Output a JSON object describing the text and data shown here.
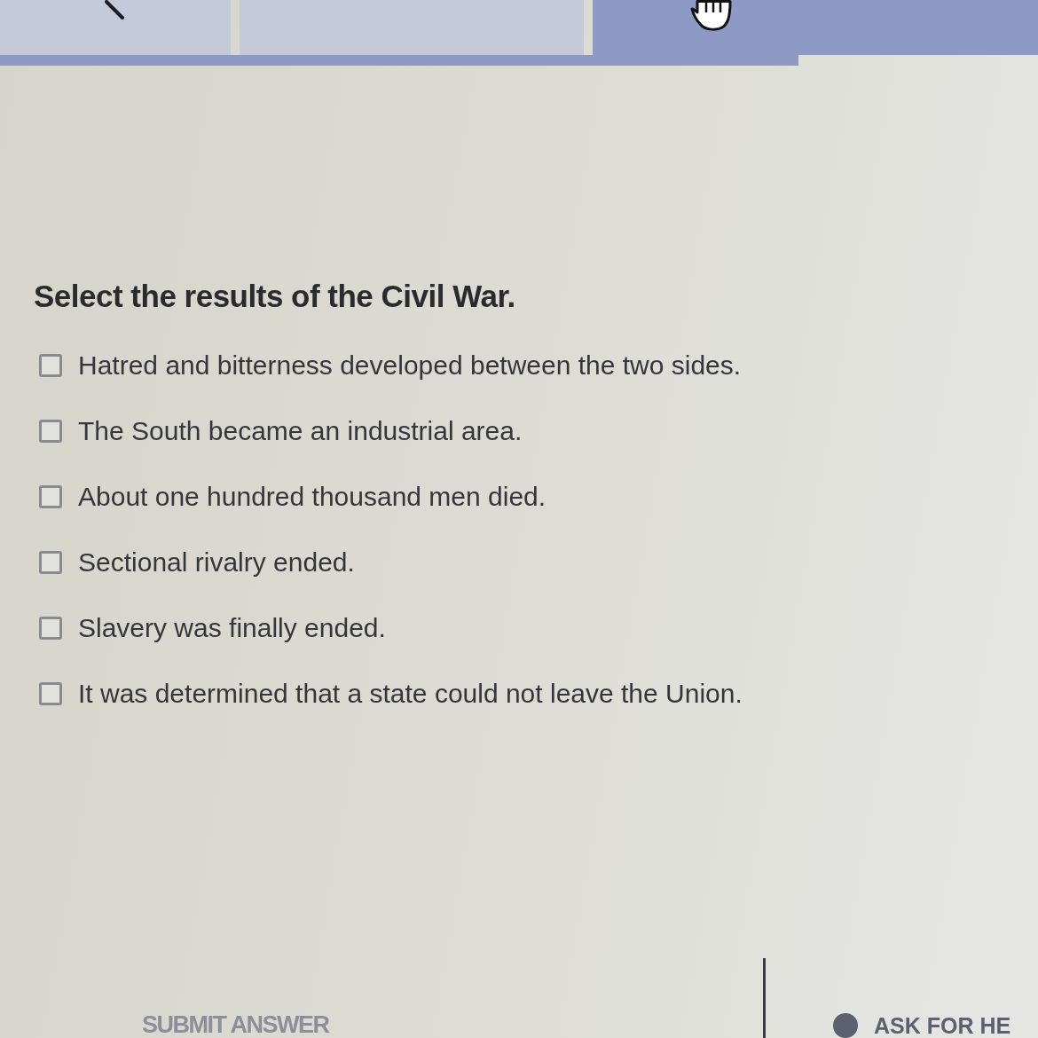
{
  "tabs": [
    {
      "selected": false
    },
    {
      "selected": false
    },
    {
      "selected": true
    }
  ],
  "question": {
    "prompt": "Select the results of the Civil War.",
    "options": [
      {
        "label": "Hatred and bitterness developed between the two sides.",
        "checked": false
      },
      {
        "label": "The South became an industrial area.",
        "checked": false
      },
      {
        "label": "About one hundred thousand men died.",
        "checked": false
      },
      {
        "label": "Sectional rivalry ended.",
        "checked": false
      },
      {
        "label": "Slavery was finally ended.",
        "checked": false
      },
      {
        "label": "It was determined that a state could not leave the Union.",
        "checked": false
      }
    ]
  },
  "footer": {
    "submit_button": "SUBMIT ANSWER",
    "help_button": "ASK FOR HE"
  }
}
